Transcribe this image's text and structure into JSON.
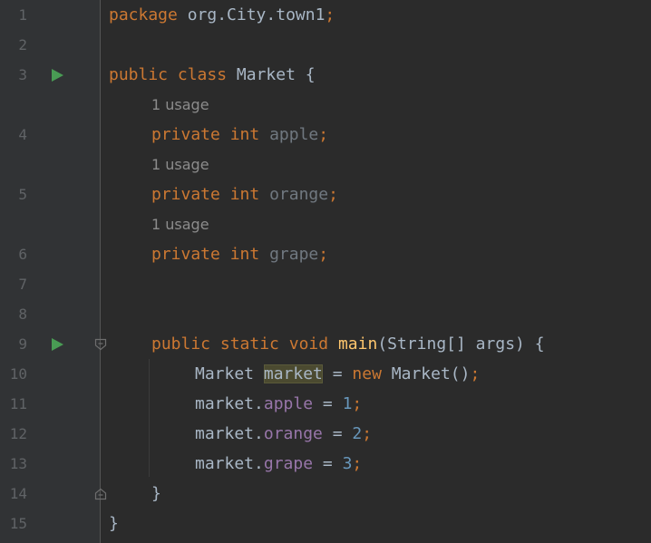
{
  "theme": {
    "background": "#2b2b2b",
    "gutter": "#313335",
    "keyword": "#cc7832",
    "function": "#ffc66d",
    "field": "#9876aa",
    "number": "#6897bb",
    "text": "#a9b7c6",
    "run_icon": "#499c54"
  },
  "gutter": {
    "line_numbers": [
      "1",
      "2",
      "3",
      "4",
      "5",
      "6",
      "7",
      "8",
      "9",
      "10",
      "11",
      "12",
      "13",
      "14",
      "15"
    ],
    "run_icon": "run-triangle-icon",
    "fold_icon": "fold-marker-icon"
  },
  "code": {
    "l1": {
      "kw": "package",
      "rest": " org.City.town1",
      "semi": ";"
    },
    "l3": {
      "kw1": "public",
      "kw2": "class",
      "name": "Market",
      "brace": "{"
    },
    "hint": "1 usage",
    "l4": {
      "kw1": "private",
      "kw2": "int",
      "name": "apple",
      "semi": ";"
    },
    "l5": {
      "kw1": "private",
      "kw2": "int",
      "name": "orange",
      "semi": ";"
    },
    "l6": {
      "kw1": "private",
      "kw2": "int",
      "name": "grape",
      "semi": ";"
    },
    "l9": {
      "kw1": "public",
      "kw2": "static",
      "kw3": "void",
      "fn": "main",
      "params": "(String[] args) {"
    },
    "l10": {
      "type": "Market",
      "var": "market",
      "eq": " = ",
      "kw": "new",
      "ctor": " Market()",
      "semi": ";"
    },
    "l11": {
      "obj": "market.",
      "field": "apple",
      "eq": " = ",
      "num": "1",
      "semi": ";"
    },
    "l12": {
      "obj": "market.",
      "field": "orange",
      "eq": " = ",
      "num": "2",
      "semi": ";"
    },
    "l13": {
      "obj": "market.",
      "field": "grape",
      "eq": " = ",
      "num": "3",
      "semi": ";"
    },
    "l14": {
      "brace": "}"
    },
    "l15": {
      "brace": "}"
    }
  }
}
